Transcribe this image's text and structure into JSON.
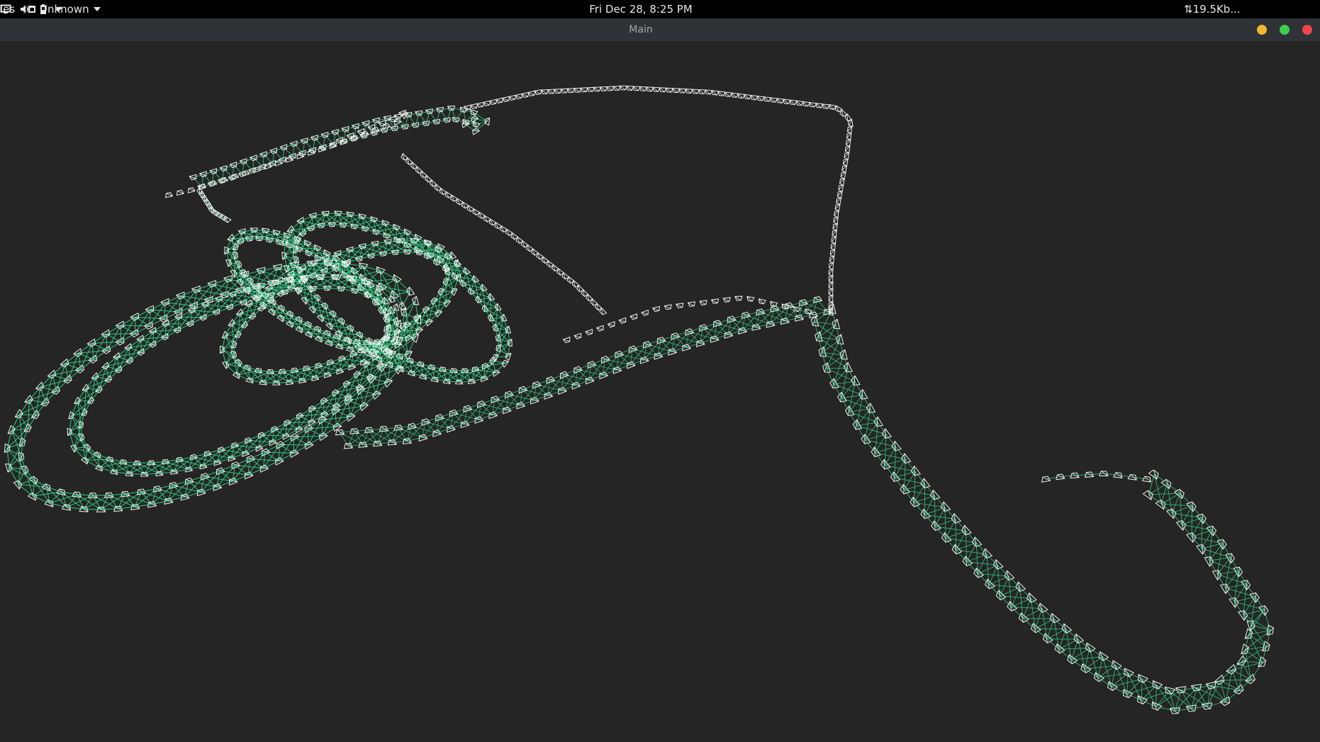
{
  "topbar": {
    "activities_label": "ies",
    "app_menu_label": "Unknown",
    "clock": "Fri Dec 28,  8:25 PM",
    "network_speed": "⇅19.5Kb..."
  },
  "window": {
    "title": "Main"
  },
  "scene": {
    "edge_color": "#2fbf7a",
    "camera_color": "#f2f2f2",
    "background_color": "#252525"
  }
}
